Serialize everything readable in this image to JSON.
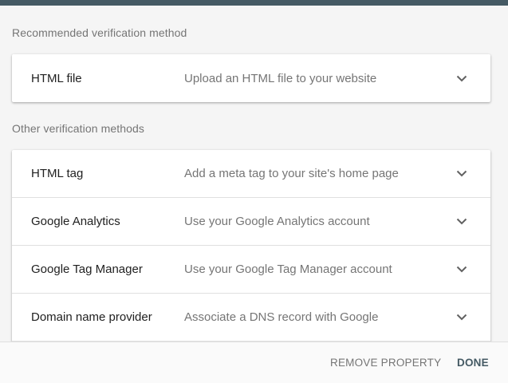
{
  "sections": {
    "recommended_label": "Recommended verification method",
    "other_label": "Other verification methods"
  },
  "recommended": {
    "title": "HTML file",
    "description": "Upload an HTML file to your website"
  },
  "other_methods": [
    {
      "title": "HTML tag",
      "description": "Add a meta tag to your site's home page"
    },
    {
      "title": "Google Analytics",
      "description": "Use your Google Analytics account"
    },
    {
      "title": "Google Tag Manager",
      "description": "Use your Google Tag Manager account"
    },
    {
      "title": "Domain name provider",
      "description": "Associate a DNS record with Google"
    }
  ],
  "footer": {
    "remove_label": "REMOVE PROPERTY",
    "done_label": "DONE"
  },
  "icons": {
    "expand": "chevron-down-icon"
  },
  "colors": {
    "header_bar": "#455a64",
    "accent": "#455a64"
  }
}
